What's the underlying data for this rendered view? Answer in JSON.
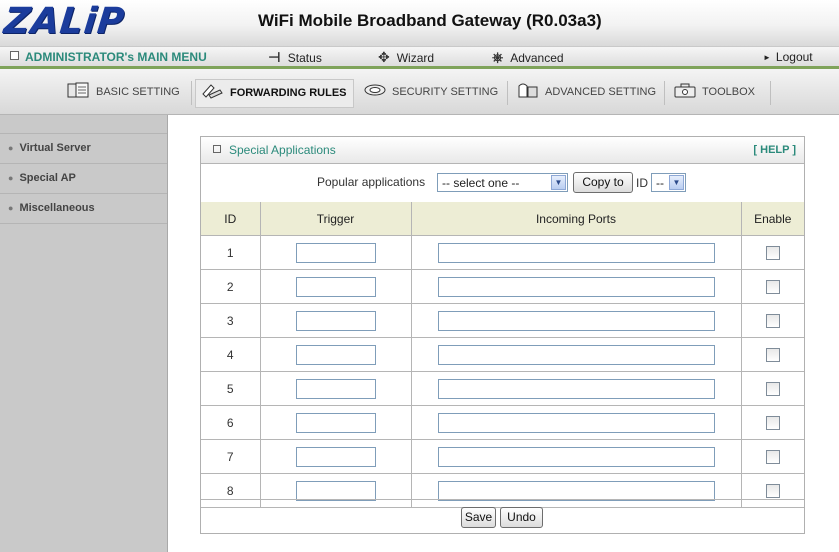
{
  "header": {
    "logo": "ZALiP",
    "title": "WiFi Mobile Broadband Gateway (R0.03a3)"
  },
  "menu": {
    "admin_label": "ADMINISTRATOR's MAIN MENU",
    "status_label": "Status",
    "wizard_label": "Wizard",
    "advanced_label": "Advanced",
    "logout_label": "Logout"
  },
  "tabs": [
    {
      "label": "BASIC SETTING",
      "icon": "basic-setting-icon"
    },
    {
      "label": "FORWARDING RULES",
      "icon": "forwarding-rules-icon",
      "active": true
    },
    {
      "label": "SECURITY SETTING",
      "icon": "security-setting-icon"
    },
    {
      "label": "ADVANCED SETTING",
      "icon": "advanced-setting-icon"
    },
    {
      "label": "TOOLBOX",
      "icon": "toolbox-icon"
    }
  ],
  "sidebar": {
    "items": [
      {
        "label": "Virtual Server"
      },
      {
        "label": "Special AP"
      },
      {
        "label": "Miscellaneous"
      }
    ]
  },
  "panel": {
    "title": "Special Applications",
    "help": "[ HELP ]",
    "popular_label": "Popular applications",
    "popular_select": "-- select one --",
    "copy_button": "Copy to",
    "id_label": "ID",
    "id_select": "--",
    "columns": [
      "ID",
      "Trigger",
      "Incoming Ports",
      "Enable"
    ],
    "rows": [
      {
        "id": "1",
        "trigger": "",
        "ports": "",
        "enabled": false
      },
      {
        "id": "2",
        "trigger": "",
        "ports": "",
        "enabled": false
      },
      {
        "id": "3",
        "trigger": "",
        "ports": "",
        "enabled": false
      },
      {
        "id": "4",
        "trigger": "",
        "ports": "",
        "enabled": false
      },
      {
        "id": "5",
        "trigger": "",
        "ports": "",
        "enabled": false
      },
      {
        "id": "6",
        "trigger": "",
        "ports": "",
        "enabled": false
      },
      {
        "id": "7",
        "trigger": "",
        "ports": "",
        "enabled": false
      },
      {
        "id": "8",
        "trigger": "",
        "ports": "",
        "enabled": false
      }
    ],
    "save_button": "Save",
    "undo_button": "Undo"
  },
  "colors": {
    "brand_blue": "#1b3c9c",
    "accent_teal": "#2b8a7b",
    "accent_green": "#7fa35a",
    "header_row_bg": "#ededd5"
  }
}
